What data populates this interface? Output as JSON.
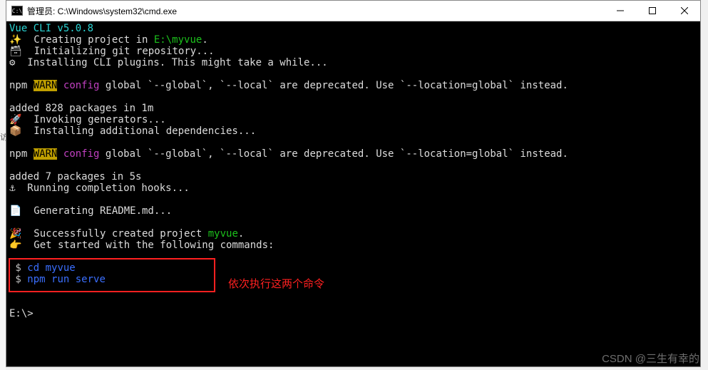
{
  "window": {
    "title": "管理员:  C:\\Windows\\system32\\cmd.exe",
    "icon_label": "C:\\"
  },
  "terminal": {
    "line1_a": "Vue CLI v5.0.8",
    "line2_a": "✨  Creating project in ",
    "line2_b": "E:\\myvue",
    "line2_c": ".",
    "line3": "🗃  Initializing git repository...",
    "line4": "⚙  Installing CLI plugins. This might take a while...",
    "line6_a": "npm",
    "line6_b": " ",
    "line6_c": "WARN",
    "line6_d": " ",
    "line6_e": "config",
    "line6_f": " global `--global`, `--local` are deprecated. Use `--location=global` instead.",
    "line8": "added 828 packages in 1m",
    "line9": "🚀  Invoking generators...",
    "line10": "📦  Installing additional dependencies...",
    "line12_a": "npm",
    "line12_b": " ",
    "line12_c": "WARN",
    "line12_d": " ",
    "line12_e": "config",
    "line12_f": " global `--global`, `--local` are deprecated. Use `--location=global` instead.",
    "line14": "added 7 packages in 5s",
    "line15": "⚓  Running completion hooks...",
    "line17": "📄  Generating README.md...",
    "line19_a": "🎉  Successfully created project ",
    "line19_b": "myvue",
    "line19_c": ".",
    "line20": "👉  Get started with the following commands:",
    "cmd1_prompt": " $ ",
    "cmd1": "cd myvue",
    "cmd2_prompt": " $ ",
    "cmd2": "npm run serve",
    "prompt": "E:\\>"
  },
  "annotation": "依次执行这两个命令",
  "watermark": "CSDN @三生有幸的",
  "left_chars": {
    "a": "访"
  }
}
